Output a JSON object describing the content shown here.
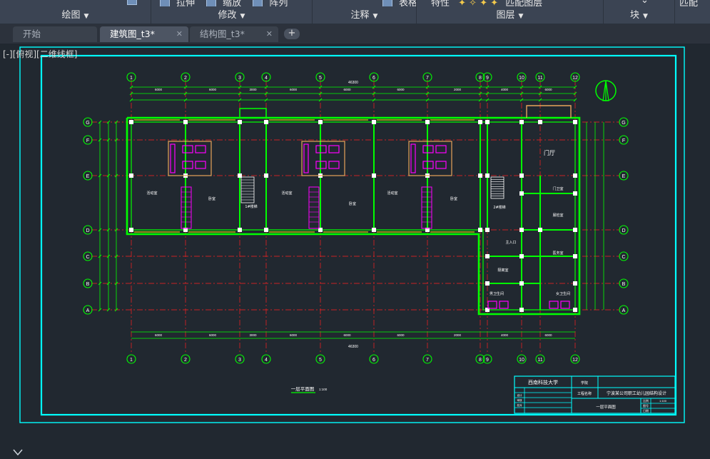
{
  "ribbon": {
    "groups": [
      {
        "title": "绘图",
        "tools": []
      },
      {
        "title": "修改",
        "tools": [
          "拉伸",
          "缩放",
          "阵列"
        ]
      },
      {
        "title": "注释",
        "tools": [
          "表格"
        ]
      },
      {
        "title": "图层",
        "tools": [
          "特性",
          "匹配图层"
        ]
      },
      {
        "title": "块",
        "tools": []
      },
      {
        "title": "",
        "tools": [
          "匹配"
        ]
      }
    ]
  },
  "tabs": [
    {
      "label": "开始",
      "closable": false,
      "active": false
    },
    {
      "label": "建筑图_t3*",
      "closable": true,
      "active": true
    },
    {
      "label": "结构图_t3*",
      "closable": true,
      "active": false
    }
  ],
  "new_tab_label": "+",
  "viewport_label": "[-][俯视][二维线框]",
  "colors": {
    "model_space": "#212830",
    "frame": "#00ffff",
    "wall": "#00ff00",
    "axis": "#ff2020",
    "column": "#ffffff",
    "fixture": "#ff00ff",
    "text": "#ffffff",
    "dimension": "#00ff00",
    "window": "#ffff00"
  },
  "drawing": {
    "axes_x": [
      "1",
      "2",
      "3",
      "4",
      "5",
      "6",
      "7",
      "8",
      "9",
      "10",
      "11",
      "12"
    ],
    "axes_y": [
      "G",
      "F",
      "E",
      "D",
      "C",
      "B",
      "A"
    ],
    "total_width_dim": "46300",
    "top_dims": [
      "6000",
      "6000",
      "3000",
      "6000",
      "6000",
      "6000",
      "2000",
      "4000",
      "6000"
    ],
    "bottom_dims": [
      "6000",
      "6000",
      "3000",
      "6000",
      "6000",
      "6000",
      "2000",
      "4000",
      "6000"
    ],
    "rooms": [
      "活动室",
      "卧室",
      "1#楼梯",
      "活动室",
      "卧室",
      "活动室",
      "卧室",
      "门厅",
      "2#楼梯",
      "门卫室",
      "晨检室",
      "主入口",
      "隔离室",
      "医务室",
      "男卫生间",
      "女卫生间"
    ],
    "plan_title": "一层平面图",
    "plan_scale": "1:100",
    "title_block": {
      "school": "西南科技大学",
      "college_label": "学院",
      "project_label": "工程名称",
      "project": "宁波某公司职工幼儿园结构设计",
      "drawing_name": "一层平面图",
      "rows": [
        "设计",
        "审核",
        "校对",
        "日期",
        "比例",
        "图号"
      ],
      "scale": "1:100"
    }
  }
}
